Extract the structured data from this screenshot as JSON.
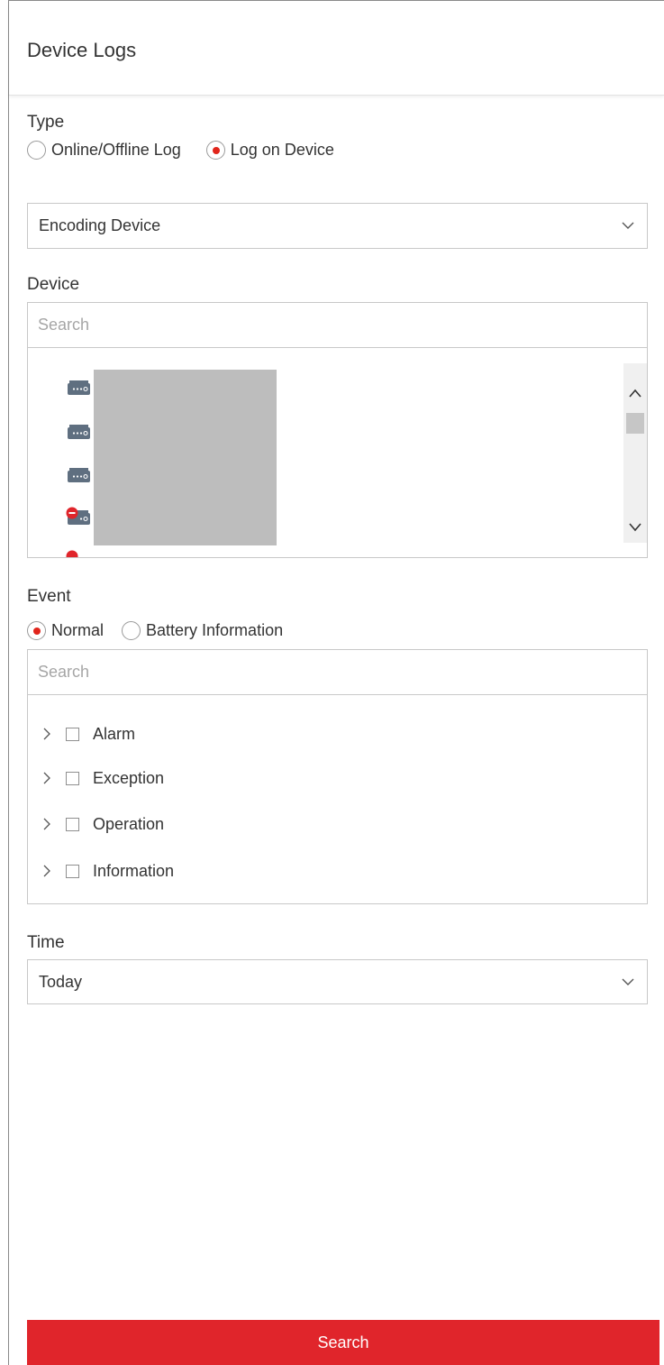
{
  "header": {
    "title": "Device Logs"
  },
  "type_section": {
    "label": "Type",
    "options": [
      {
        "label": "Online/Offline Log",
        "selected": false
      },
      {
        "label": "Log on Device",
        "selected": true
      }
    ]
  },
  "device_type_select": {
    "value": "Encoding Device"
  },
  "device_section": {
    "label": "Device",
    "search_placeholder": "Search",
    "items": [
      {
        "icon": "encoding-device-icon",
        "status": "online"
      },
      {
        "icon": "encoding-device-icon",
        "status": "online"
      },
      {
        "icon": "encoding-device-icon",
        "status": "online"
      },
      {
        "icon": "encoding-device-icon",
        "status": "offline"
      }
    ]
  },
  "event_section": {
    "label": "Event",
    "options": [
      {
        "label": "Normal",
        "selected": true
      },
      {
        "label": "Battery Information",
        "selected": false
      }
    ],
    "search_placeholder": "Search",
    "items": [
      {
        "label": "Alarm",
        "checked": false
      },
      {
        "label": "Exception",
        "checked": false
      },
      {
        "label": "Operation",
        "checked": false
      },
      {
        "label": "Information",
        "checked": false
      }
    ]
  },
  "time_section": {
    "label": "Time",
    "value": "Today"
  },
  "search_button": {
    "label": "Search"
  },
  "colors": {
    "accent": "#e0252b",
    "radio_dot": "#e1251b",
    "device_icon": "#5f6f80"
  }
}
